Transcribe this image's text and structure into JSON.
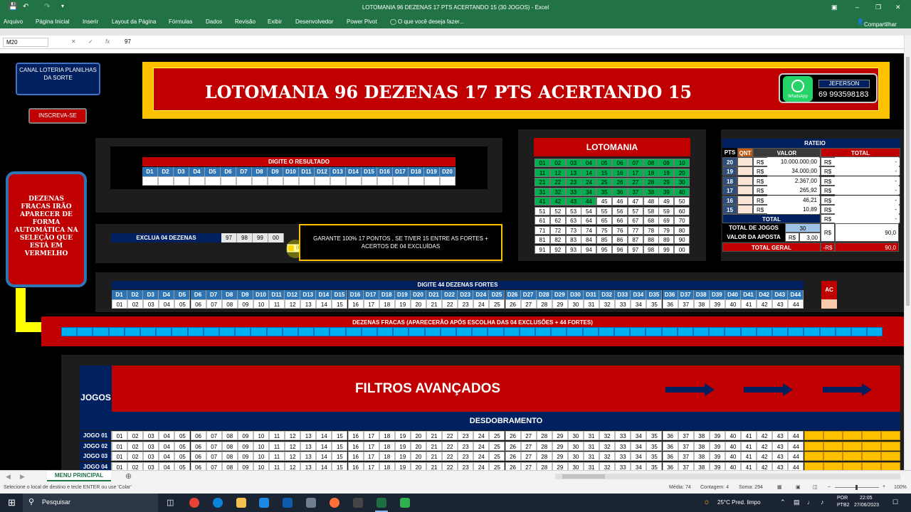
{
  "window": {
    "title": "LOTOMANIA 96 DEZENAS 17 PTS ACERTANDO 15 (30 JOGOS) - Excel",
    "autosave": "AutoSave"
  },
  "ribbon": {
    "tabs": [
      "Arquivo",
      "Página Inicial",
      "Inserir",
      "Layout da Página",
      "Fórmulas",
      "Dados",
      "Revisão",
      "Exibir",
      "Desenvolvedor",
      "Power Pivot"
    ],
    "tell_me": "O que você deseja fazer...",
    "share": "Compartilhar"
  },
  "formula_bar": {
    "name_box": "M20",
    "value": "97"
  },
  "sheet": {
    "canal": "CANAL LOTERIA PLANILHAS DA SORTE",
    "inscreva": "INSCREVA-SE",
    "banner_title": "LOTOMANIA 96 DEZENAS 17 PTS ACERTANDO 15",
    "whatsapp_label": "WhatsApp",
    "contact_name": "JEFERSON",
    "contact_phone": "69 993598183",
    "dezenas_fracas_note": "DEZENAS FRACAS IRÃO APARECER DE FORMA AUTOMÁTICA NA SELEÇÃO QUE ESTÁ EM VERMELHO",
    "resultado_title": "DIGITE O RESULTADO",
    "resultado_headers": [
      "D1",
      "D2",
      "D3",
      "D4",
      "D5",
      "D6",
      "D7",
      "D8",
      "D9",
      "D10",
      "D11",
      "D12",
      "D13",
      "D14",
      "D15",
      "D16",
      "D17",
      "D18",
      "D19",
      "D20"
    ],
    "exclua_label": "EXCLUA 04 DEZENAS",
    "exclua_values": [
      "97",
      "98",
      "99",
      "00"
    ],
    "paste_tag": "(Ctrl)",
    "garante_text": "GARANTE 100% 17 PONTOS , SE TIVER 15 ENTRE AS FORTES + ACERTOS DE 04 EXCLUÍDAS",
    "lotomania_title": "LOTOMANIA",
    "lotomania_grid": [
      [
        "01",
        "02",
        "03",
        "04",
        "05",
        "06",
        "07",
        "08",
        "09",
        "10"
      ],
      [
        "11",
        "12",
        "13",
        "14",
        "15",
        "16",
        "17",
        "18",
        "19",
        "20"
      ],
      [
        "21",
        "22",
        "23",
        "24",
        "25",
        "26",
        "27",
        "28",
        "29",
        "30"
      ],
      [
        "31",
        "32",
        "33",
        "34",
        "35",
        "36",
        "37",
        "38",
        "39",
        "40"
      ],
      [
        "41",
        "42",
        "43",
        "44",
        "45",
        "46",
        "47",
        "48",
        "49",
        "50"
      ],
      [
        "51",
        "52",
        "53",
        "54",
        "55",
        "56",
        "57",
        "58",
        "59",
        "60"
      ],
      [
        "61",
        "62",
        "63",
        "64",
        "65",
        "66",
        "67",
        "68",
        "69",
        "70"
      ],
      [
        "71",
        "72",
        "73",
        "74",
        "75",
        "76",
        "77",
        "78",
        "79",
        "80"
      ],
      [
        "81",
        "82",
        "83",
        "84",
        "85",
        "86",
        "87",
        "88",
        "89",
        "90"
      ],
      [
        "91",
        "92",
        "93",
        "94",
        "95",
        "96",
        "97",
        "98",
        "99",
        "00"
      ]
    ],
    "lotomania_green_count": 44,
    "rateio": {
      "title": "RATEIO",
      "headers": [
        "PTS",
        "QNT",
        "VALOR",
        "TOTAL"
      ],
      "rows": [
        {
          "pts": "20",
          "cur": "R$",
          "valor": "10.000.000,00",
          "tcur": "R$",
          "total": "-"
        },
        {
          "pts": "19",
          "cur": "R$",
          "valor": "34.000,00",
          "tcur": "R$",
          "total": "-"
        },
        {
          "pts": "18",
          "cur": "R$",
          "valor": "2.367,00",
          "tcur": "R$",
          "total": "-"
        },
        {
          "pts": "17",
          "cur": "R$",
          "valor": "265,92",
          "tcur": "R$",
          "total": "-"
        },
        {
          "pts": "16",
          "cur": "R$",
          "valor": "46,21",
          "tcur": "R$",
          "total": "-"
        },
        {
          "pts": "15",
          "cur": "R$",
          "valor": "10,89",
          "tcur": "R$",
          "total": "-"
        }
      ],
      "total_label": "TOTAL",
      "total_cur": "R$",
      "total_val": "-",
      "total_jogos_label": "TOTAL DE JOGOS",
      "total_jogos": "30",
      "valor_aposta_label": "VALOR DA APOSTA",
      "valor_aposta_cur": "R$",
      "valor_aposta": "3,00",
      "aposta_total_cur": "R$",
      "aposta_total": "90,0",
      "total_geral_label": "TOTAL GERAL",
      "total_geral_cur": "-R$",
      "total_geral": "90,0"
    },
    "fortes_title": "DIGITE 44 DEZENAS FORTES",
    "fortes_headers": [
      "D1",
      "D2",
      "D3",
      "D4",
      "D5",
      "D6",
      "D7",
      "D8",
      "D9",
      "D10",
      "D11",
      "D12",
      "D13",
      "D14",
      "D15",
      "D16",
      "D17",
      "D18",
      "D19",
      "D20",
      "D21",
      "D22",
      "D23",
      "D24",
      "D25",
      "D26",
      "D27",
      "D28",
      "D29",
      "D30",
      "D31",
      "D32",
      "D33",
      "D34",
      "D35",
      "D36",
      "D37",
      "D38",
      "D39",
      "D40",
      "D41",
      "D42",
      "D43",
      "D44"
    ],
    "fortes_values": [
      "01",
      "02",
      "03",
      "04",
      "05",
      "06",
      "07",
      "08",
      "09",
      "10",
      "11",
      "12",
      "13",
      "14",
      "15",
      "16",
      "17",
      "18",
      "19",
      "20",
      "21",
      "22",
      "23",
      "24",
      "25",
      "26",
      "27",
      "28",
      "29",
      "30",
      "31",
      "32",
      "33",
      "34",
      "35",
      "36",
      "37",
      "38",
      "39",
      "40",
      "41",
      "42",
      "43",
      "44"
    ],
    "ac_label": "AC",
    "fracas_title": "DEZENAS FRACAS (APARECERÃO APÓS ESCOLHA DAS 04 EXCLUSÕES + 44 FORTES)",
    "jogos_label": "JOGOS",
    "filtros_title": "FILTROS AVANÇADOS",
    "desdobramento_title": "DESDOBRAMENTO",
    "jogos_rows": [
      {
        "label": "JOGO 01"
      },
      {
        "label": "JOGO 02"
      },
      {
        "label": "JOGO 03"
      },
      {
        "label": "JOGO 04"
      }
    ]
  },
  "sheet_tab": "MENU PRINCIPAL",
  "status": {
    "left": "Selecione o local de destino e tecle ENTER ou use 'Colar'",
    "media": "Média: 74",
    "contagem": "Contagem: 4",
    "soma": "Soma: 294",
    "zoom": "100%"
  },
  "taskbar": {
    "search": "Pesquisar",
    "weather": "25°C  Pred. limpo",
    "lang": "POR",
    "kb": "PTB2",
    "time": "22:05",
    "date": "27/06/2023"
  },
  "colors": {
    "excel_green": "#217346",
    "red": "#c00000",
    "navy": "#002060",
    "blue_hdr": "#2e75b6",
    "yellow": "#ffc000",
    "green": "#00b050",
    "cyan": "#00b0f0"
  }
}
